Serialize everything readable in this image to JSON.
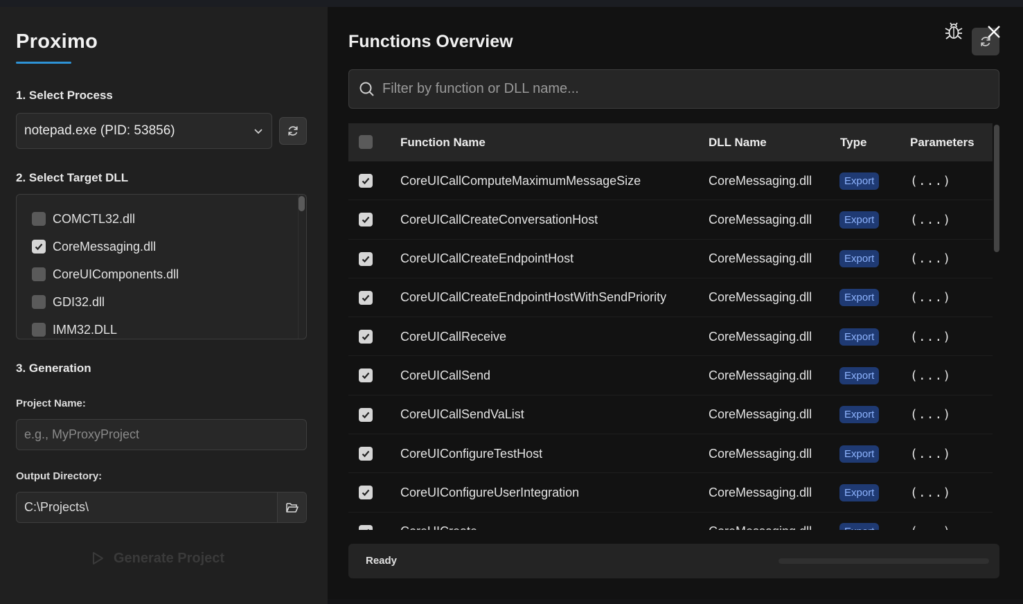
{
  "app": {
    "title": "Proximo"
  },
  "sidebar": {
    "section1_label": "1. Select Process",
    "process_value": "notepad.exe (PID: 53856)",
    "section2_label": "2. Select Target DLL",
    "dlls": [
      {
        "name": "COMCTL32.dll",
        "checked": false
      },
      {
        "name": "CoreMessaging.dll",
        "checked": true
      },
      {
        "name": "CoreUIComponents.dll",
        "checked": false
      },
      {
        "name": "GDI32.dll",
        "checked": false
      },
      {
        "name": "IMM32.DLL",
        "checked": false
      }
    ],
    "section3_label": "3. Generation",
    "project_name_label": "Project Name:",
    "project_name_placeholder": "e.g., MyProxyProject",
    "output_dir_label": "Output Directory:",
    "output_dir_value": "C:\\Projects\\",
    "generate_label": "Generate Project"
  },
  "main": {
    "title": "Functions Overview",
    "search_placeholder": "Filter by function or DLL name...",
    "columns": {
      "name": "Function Name",
      "dll": "DLL Name",
      "type": "Type",
      "params": "Parameters"
    },
    "header_checked": false,
    "rows": [
      {
        "checked": true,
        "name": "CoreUICallComputeMaximumMessageSize",
        "dll": "CoreMessaging.dll",
        "type": "Export",
        "params": "(...)"
      },
      {
        "checked": true,
        "name": "CoreUICallCreateConversationHost",
        "dll": "CoreMessaging.dll",
        "type": "Export",
        "params": "(...)"
      },
      {
        "checked": true,
        "name": "CoreUICallCreateEndpointHost",
        "dll": "CoreMessaging.dll",
        "type": "Export",
        "params": "(...)"
      },
      {
        "checked": true,
        "name": "CoreUICallCreateEndpointHostWithSendPriority",
        "dll": "CoreMessaging.dll",
        "type": "Export",
        "params": "(...)"
      },
      {
        "checked": true,
        "name": "CoreUICallReceive",
        "dll": "CoreMessaging.dll",
        "type": "Export",
        "params": "(...)"
      },
      {
        "checked": true,
        "name": "CoreUICallSend",
        "dll": "CoreMessaging.dll",
        "type": "Export",
        "params": "(...)"
      },
      {
        "checked": true,
        "name": "CoreUICallSendVaList",
        "dll": "CoreMessaging.dll",
        "type": "Export",
        "params": "(...)"
      },
      {
        "checked": true,
        "name": "CoreUIConfigureTestHost",
        "dll": "CoreMessaging.dll",
        "type": "Export",
        "params": "(...)"
      },
      {
        "checked": true,
        "name": "CoreUIConfigureUserIntegration",
        "dll": "CoreMessaging.dll",
        "type": "Export",
        "params": "(...)"
      },
      {
        "checked": true,
        "name": "CoreUICreate",
        "dll": "CoreMessaging.dll",
        "type": "Export",
        "params": "(...)"
      }
    ],
    "status_text": "Ready",
    "progress": 0
  },
  "colors": {
    "accent": "#2e93d6",
    "badge_bg": "#1f3a73",
    "badge_text": "#8eb4ff"
  },
  "icons": [
    "chevron-down-icon",
    "refresh-icon",
    "checkbox-icon",
    "folder-open-icon",
    "play-icon",
    "bug-icon",
    "sync-icon",
    "close-icon",
    "search-icon"
  ]
}
